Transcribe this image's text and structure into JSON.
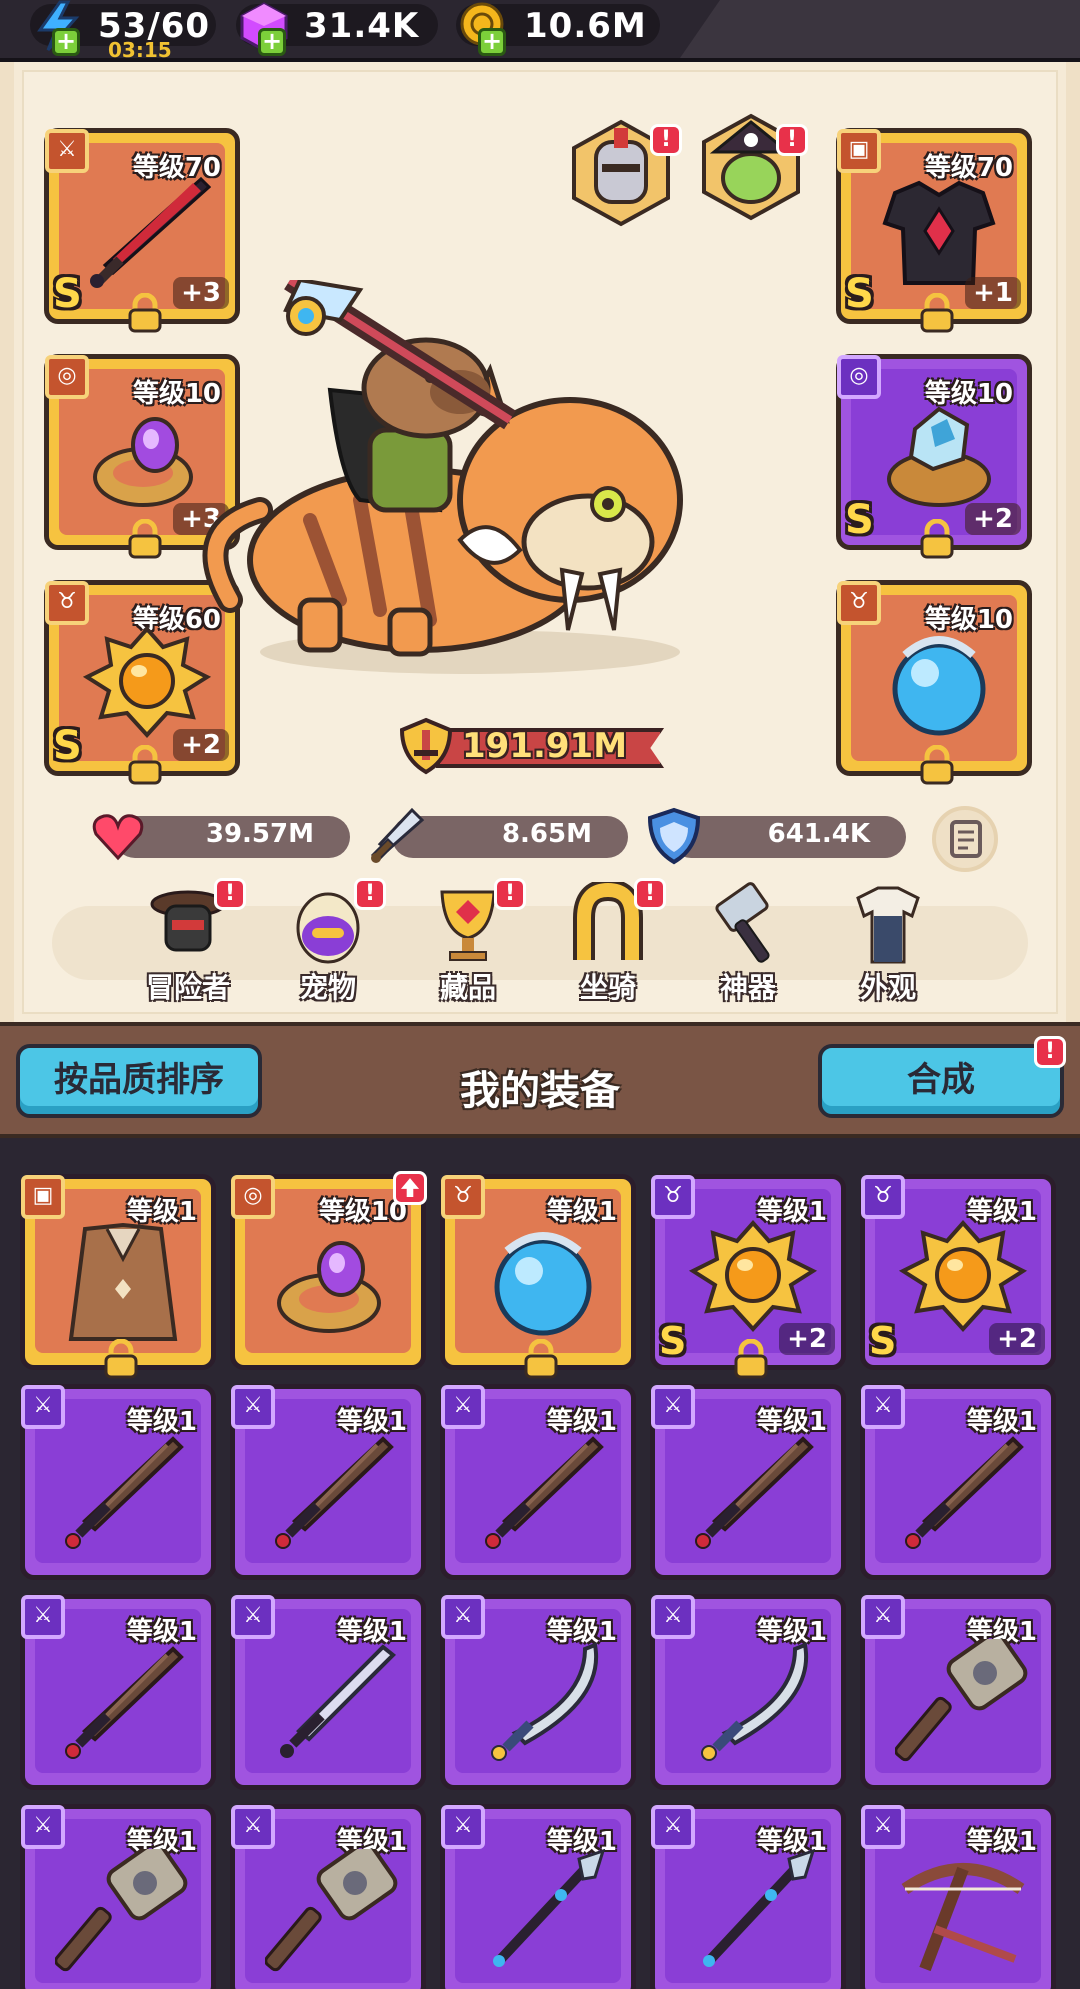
{
  "resources": {
    "energy": {
      "value": "53/60",
      "timer": "03:15",
      "icon": "lightning-icon"
    },
    "gems": {
      "value": "31.4K",
      "icon": "gem-icon"
    },
    "coins": {
      "value": "10.6M",
      "icon": "coin-icon"
    }
  },
  "equipped": {
    "weapon": {
      "level": "等级70",
      "grade": "S",
      "plus": "+3",
      "icon": "sword-icon",
      "rarity": "gold"
    },
    "ring": {
      "level": "等级10",
      "plus": "+3",
      "icon": "ring-icon",
      "rarity": "gold"
    },
    "amulet": {
      "level": "等级60",
      "grade": "S",
      "plus": "+2",
      "icon": "medal-icon",
      "rarity": "gold"
    },
    "armor": {
      "level": "等级70",
      "grade": "S",
      "plus": "+1",
      "icon": "armor-icon",
      "rarity": "gold"
    },
    "bracelet": {
      "level": "等级10",
      "grade": "S",
      "plus": "+2",
      "icon": "bracelet-icon",
      "rarity": "purple"
    },
    "orb": {
      "level": "等级10",
      "icon": "orb-icon",
      "rarity": "gold"
    }
  },
  "power": "191.91M",
  "stats": {
    "hp": "39.57M",
    "attack": "8.65M",
    "defense": "641.4K"
  },
  "nav": [
    {
      "label": "冒险者",
      "icon": "adventurer-icon",
      "badge": "!"
    },
    {
      "label": "宠物",
      "icon": "pet-egg-icon",
      "badge": "!"
    },
    {
      "label": "藏品",
      "icon": "trophy-icon",
      "badge": "!"
    },
    {
      "label": "坐骑",
      "icon": "horseshoe-icon",
      "badge": "!"
    },
    {
      "label": "神器",
      "icon": "hammer-icon"
    },
    {
      "label": "外观",
      "icon": "outfit-icon"
    }
  ],
  "actions": {
    "sort_label": "按品质排序",
    "title": "我的装备",
    "merge_label": "合成",
    "merge_badge": "!"
  },
  "badges": {
    "avatar": "!"
  },
  "inventory": [
    {
      "level": "等级1",
      "rarity": "gold",
      "icon": "cloak-icon",
      "locked": true
    },
    {
      "level": "等级10",
      "rarity": "gold",
      "icon": "ring-icon",
      "upgrade": true
    },
    {
      "level": "等级1",
      "rarity": "gold",
      "icon": "orb-icon",
      "locked": true
    },
    {
      "level": "等级1",
      "rarity": "purple",
      "icon": "medal-icon",
      "grade": "S",
      "plus": "+2",
      "locked": true
    },
    {
      "level": "等级1",
      "rarity": "purple",
      "icon": "medal-icon",
      "grade": "S",
      "plus": "+2"
    },
    {
      "level": "等级1",
      "rarity": "purple",
      "icon": "wooden-sword-icon"
    },
    {
      "level": "等级1",
      "rarity": "purple",
      "icon": "wooden-sword-icon"
    },
    {
      "level": "等级1",
      "rarity": "purple",
      "icon": "wooden-sword-icon"
    },
    {
      "level": "等级1",
      "rarity": "purple",
      "icon": "wooden-sword-icon"
    },
    {
      "level": "等级1",
      "rarity": "purple",
      "icon": "wooden-sword-icon"
    },
    {
      "level": "等级1",
      "rarity": "purple",
      "icon": "wooden-sword-icon"
    },
    {
      "level": "等级1",
      "rarity": "purple",
      "icon": "iron-sword-icon"
    },
    {
      "level": "等级1",
      "rarity": "purple",
      "icon": "scimitar-icon"
    },
    {
      "level": "等级1",
      "rarity": "purple",
      "icon": "scimitar-icon"
    },
    {
      "level": "等级1",
      "rarity": "purple",
      "icon": "warhammer-icon"
    },
    {
      "level": "等级1",
      "rarity": "purple",
      "icon": "warhammer-icon"
    },
    {
      "level": "等级1",
      "rarity": "purple",
      "icon": "warhammer-icon"
    },
    {
      "level": "等级1",
      "rarity": "purple",
      "icon": "spear-icon"
    },
    {
      "level": "等级1",
      "rarity": "purple",
      "icon": "spear-icon"
    },
    {
      "level": "等级1",
      "rarity": "purple",
      "icon": "crossbow-icon"
    }
  ],
  "colors": {
    "gold_slot": "#f6c340",
    "purple_slot": "#a054e0",
    "button": "#4cc6e6",
    "power_bar": "#c94545"
  }
}
